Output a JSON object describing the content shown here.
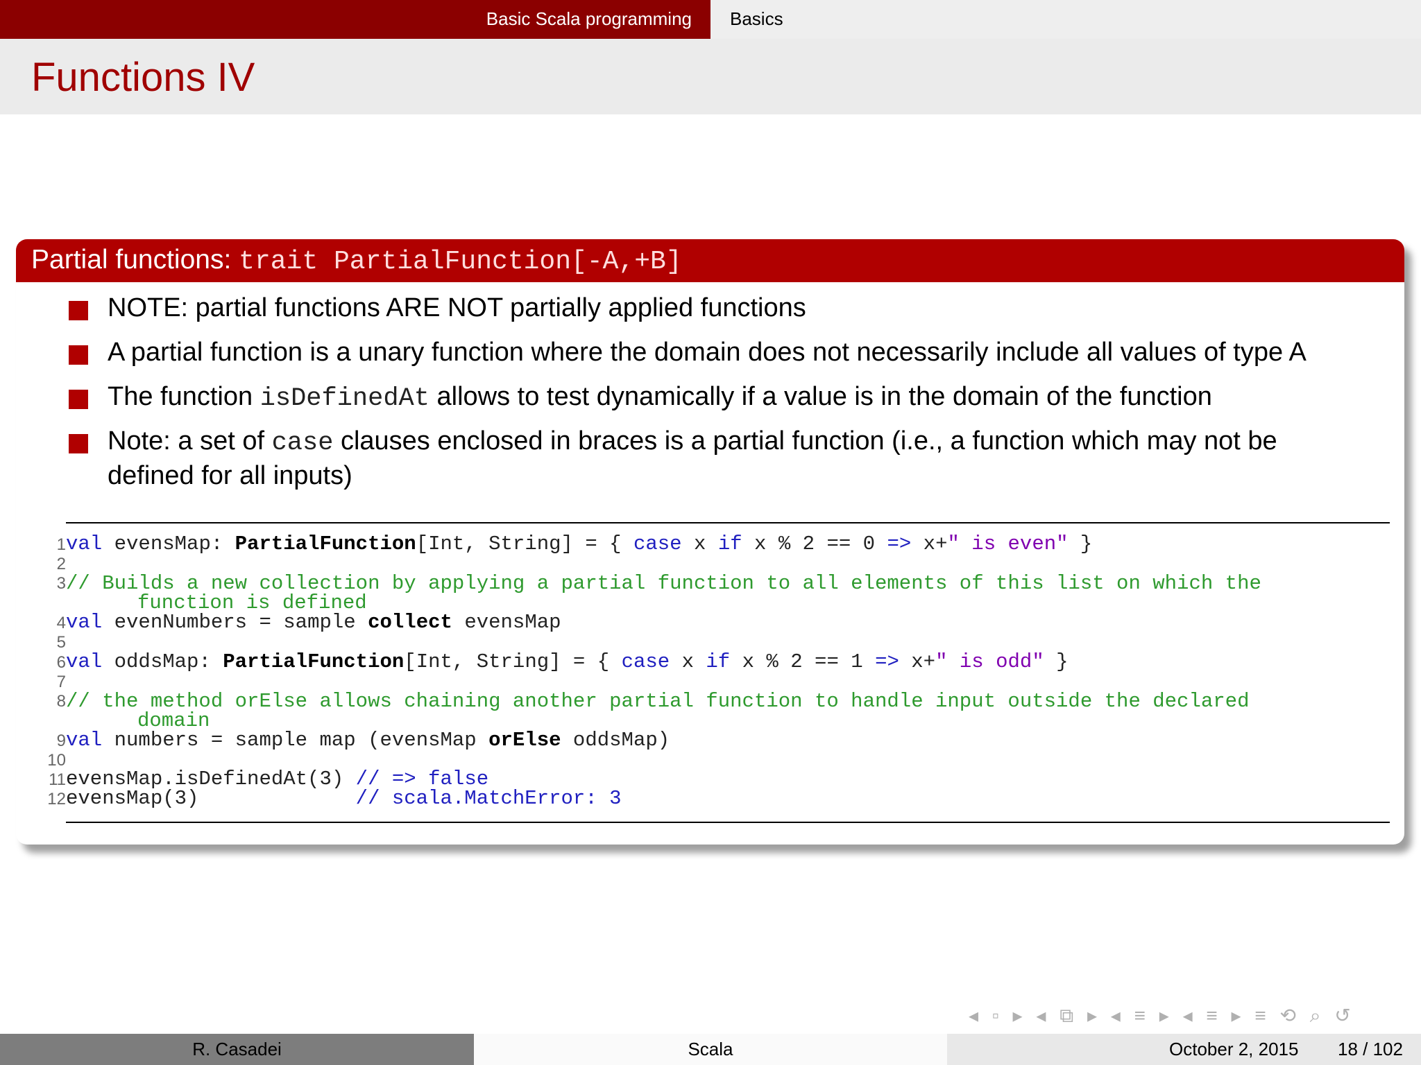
{
  "nav": {
    "section": "Basic Scala programming",
    "subsection": "Basics"
  },
  "title": "Functions IV",
  "block": {
    "title_text": "Partial functions: ",
    "title_code": "trait PartialFunction[-A,+B]"
  },
  "bullets": [
    {
      "text": "NOTE: partial functions ARE NOT partially applied functions"
    },
    {
      "text": "A partial function is a unary function where the domain does not necessarily include all values of type A"
    },
    {
      "pre": "The function ",
      "code": "isDefinedAt",
      "post": " allows to test dynamically if a value is in the domain of the function"
    },
    {
      "pre": "Note: a set of ",
      "code": "case",
      "post": " clauses enclosed in braces is a partial function (i.e., a function which may not be",
      "line2": "defined for all inputs)"
    }
  ],
  "code": {
    "line_numbers": [
      "1",
      "2",
      "3",
      "4",
      "5",
      "6",
      "7",
      "8",
      "9",
      "10",
      "11",
      "12"
    ],
    "l1": {
      "a": "val",
      "b": " evensMap: ",
      "c": "PartialFunction",
      "d": "[Int, String] = { ",
      "e": "case",
      "f": " x ",
      "g": "if",
      "h": " x % 2 == 0 ",
      "i": "=>",
      "j": " x+",
      "k": "\" is even\"",
      "l": " }"
    },
    "l3a": "// Builds a new collection by applying a partial function to all elements of this list on which the",
    "l3b": "function is defined",
    "l4": {
      "a": "val",
      "b": " evenNumbers = sample ",
      "c": "collect",
      "d": " evensMap"
    },
    "l6": {
      "a": "val",
      "b": " oddsMap: ",
      "c": "PartialFunction",
      "d": "[Int, String] = { ",
      "e": "case",
      "f": " x ",
      "g": "if",
      "h": " x % 2 == 1 ",
      "i": "=>",
      "j": " x+",
      "k": "\" is odd\"",
      "l": " }"
    },
    "l8a": "// the method orElse allows chaining another partial function to handle input outside the declared",
    "l8b": "domain",
    "l9": {
      "a": "val",
      "b": " numbers = sample map (evensMap ",
      "c": "orElse",
      "d": " oddsMap)"
    },
    "l11": {
      "a": "evensMap.isDefinedAt(3) ",
      "b": "//",
      "c": " ",
      "d": "=>",
      "e": " false"
    },
    "l12": {
      "a": "evensMap(3)             ",
      "b": "// scala.MatchError: 3"
    }
  },
  "footer": {
    "author": "R. Casadei",
    "title": "Scala",
    "date": "October 2, 2015",
    "page": "18 / 102"
  },
  "nav_symbols": "◂ ▫ ▸ ◂ ⧉ ▸ ◂ ≡ ▸ ◂ ≡ ▸ ≡ ⟲ ⌕ ↺"
}
